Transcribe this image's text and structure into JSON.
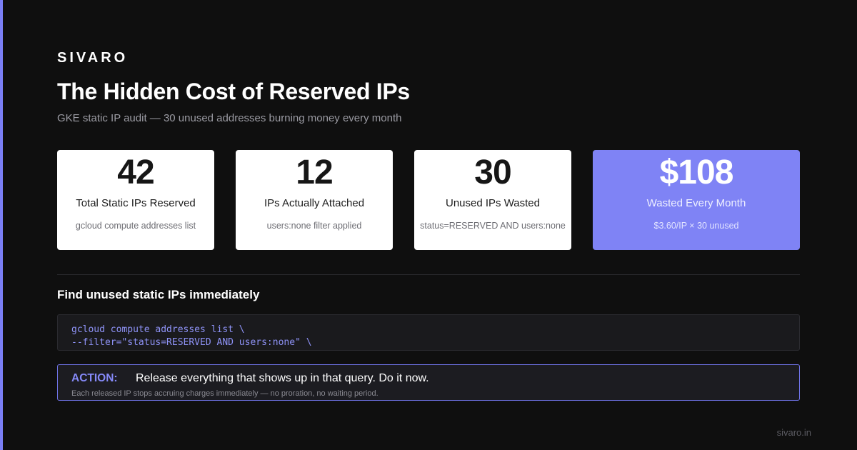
{
  "brand": "SIVARO",
  "title": "The Hidden Cost of Reserved IPs",
  "subtitle": "GKE static IP audit — 30 unused addresses burning money every month",
  "cards": [
    {
      "value": "42",
      "label": "Total Static IPs Reserved",
      "hint": "gcloud compute addresses list"
    },
    {
      "value": "12",
      "label": "IPs Actually Attached",
      "hint": "users:none filter applied"
    },
    {
      "value": "30",
      "label": "Unused IPs Wasted",
      "hint": "status=RESERVED AND users:none"
    },
    {
      "value": "$108",
      "label": "Wasted Every Month",
      "hint": "$3.60/IP × 30 unused"
    }
  ],
  "section_heading": "Find unused static IPs immediately",
  "code": {
    "line1": "gcloud compute addresses list \\",
    "line2": "--filter=\"status=RESERVED AND users:none\" \\"
  },
  "action": {
    "label": "ACTION:",
    "text": "Release everything that shows up in that query. Do it now.",
    "note": "Each released IP stops accruing charges immediately — no proration, no waiting period."
  },
  "footer": "sivaro.in",
  "colors": {
    "accent": "#7f83f5",
    "background": "#0f0f0f",
    "card": "#ffffff"
  }
}
